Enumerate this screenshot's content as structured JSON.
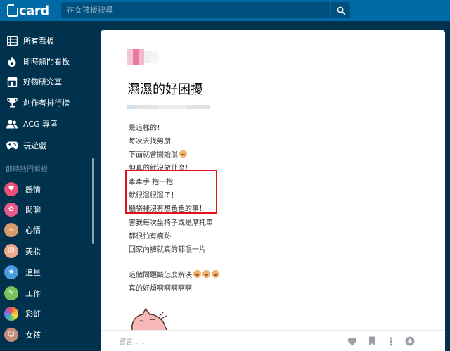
{
  "header": {
    "logo_text": "card",
    "search_placeholder": "在女孩板搜尋"
  },
  "sidebar": {
    "nav": [
      {
        "label": "所有看板",
        "icon": "list-icon"
      },
      {
        "label": "即時熱門看板",
        "icon": "flame-icon"
      },
      {
        "label": "好物研究室",
        "icon": "store-icon"
      },
      {
        "label": "創作者排行榜",
        "icon": "trophy-icon"
      },
      {
        "label": "ACG 專區",
        "icon": "users-icon"
      },
      {
        "label": "玩遊戲",
        "icon": "gamepad-icon"
      }
    ],
    "section_title": "即時熱門看板",
    "boards": [
      {
        "label": "感情",
        "color": "#e8507a"
      },
      {
        "label": "閒聊",
        "color": "#e85a8e"
      },
      {
        "label": "心情",
        "color": "#d99a6c"
      },
      {
        "label": "美妝",
        "color": "#f2a98a"
      },
      {
        "label": "追星",
        "color": "#4a9be0"
      },
      {
        "label": "工作",
        "color": "#7ac35a"
      },
      {
        "label": "彩虹",
        "color": "#e94f4f"
      },
      {
        "label": "女孩",
        "color": "#c58b7a"
      }
    ]
  },
  "post": {
    "title": "濕濕的好困擾",
    "lines": [
      "是這樣的！",
      "每次去找男朋",
      "下面就會開始濕",
      "但真的就沒做什麼！",
      "牽牽手 抱一抱",
      "就很濕很濕了！",
      "腦袋裡沒有想色色的事！",
      "害我每次坐椅子或是摩托車",
      "都很怕有痕跡",
      "回家內褲就真的都濕一片",
      "",
      "這個問題該怎麼解決",
      "真的好煩啊啊啊啊啊"
    ],
    "comment_placeholder": "留言……"
  },
  "colors": {
    "header": "#006aa6",
    "sidebar": "#00324e",
    "highlight": "#e3121a"
  }
}
